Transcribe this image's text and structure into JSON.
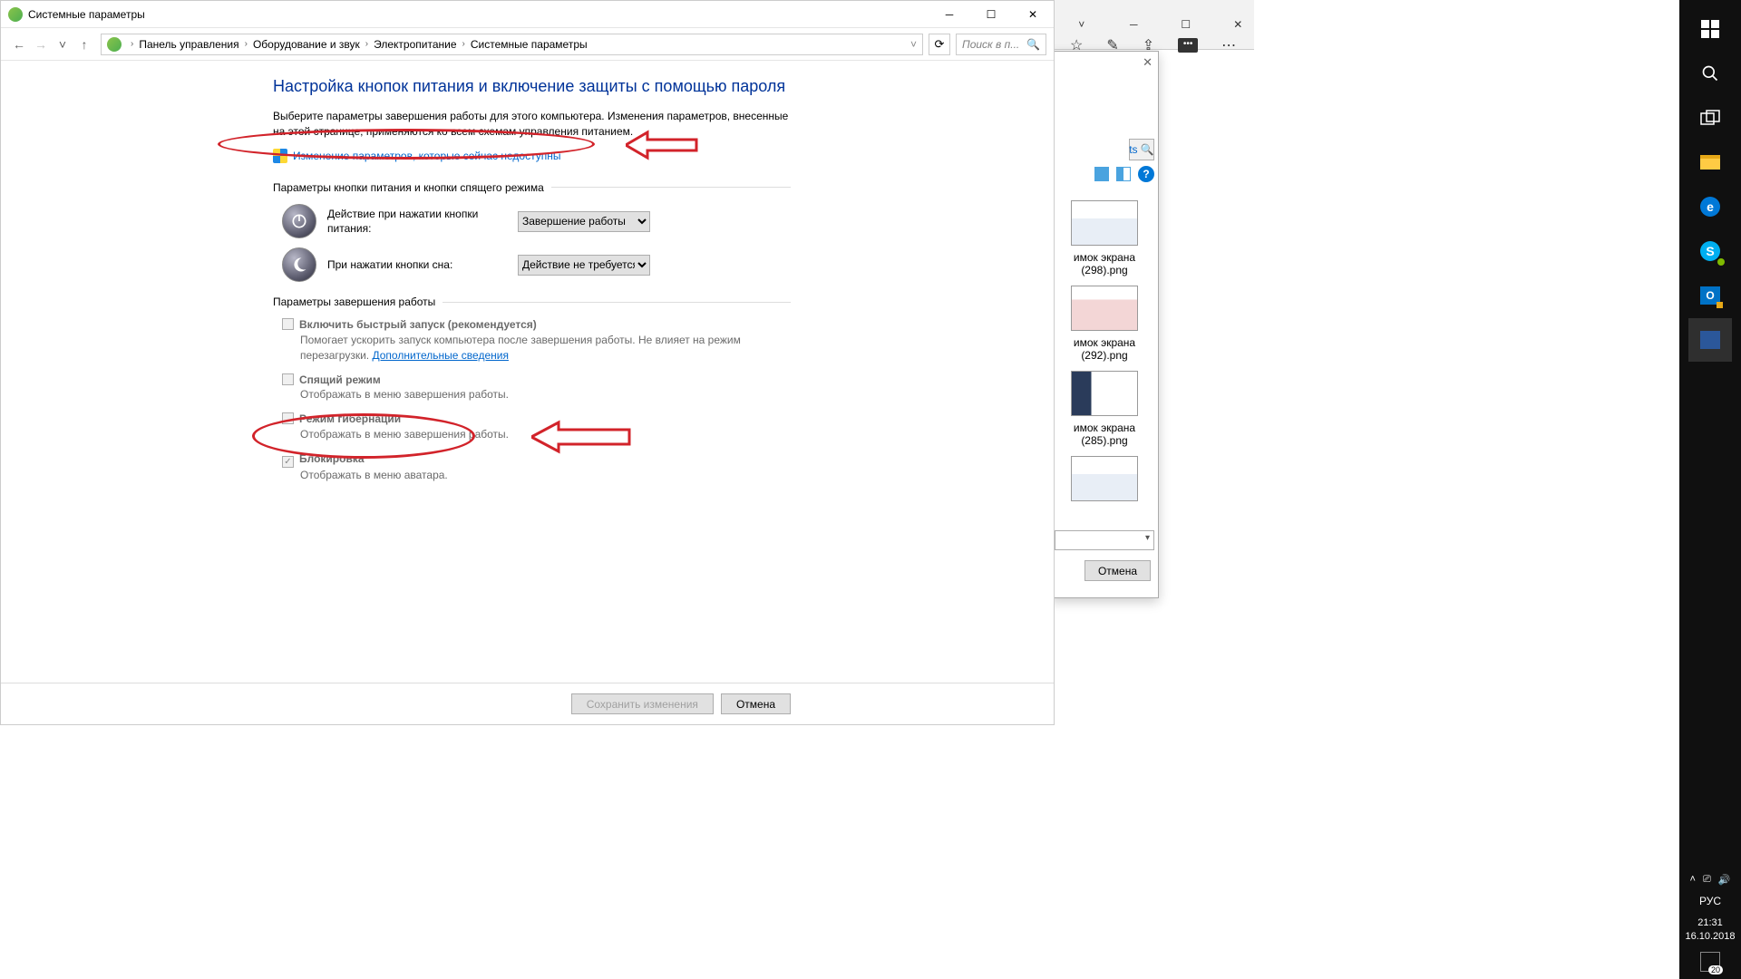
{
  "window": {
    "title": "Системные параметры"
  },
  "breadcrumb": {
    "root": "Панель управления",
    "items": [
      "Оборудование и звук",
      "Электропитание",
      "Системные параметры"
    ]
  },
  "search": {
    "placeholder": "Поиск в п..."
  },
  "page": {
    "heading": "Настройка кнопок питания и включение защиты с помощью пароля",
    "intro": "Выберите параметры завершения работы для этого компьютера. Изменения параметров, внесенные на этой странице, применяются ко всем схемам управления питанием.",
    "uac_link": "Изменение параметров, которые сейчас недоступны",
    "section_buttons": "Параметры кнопки питания и кнопки спящего режима",
    "power_button_label": "Действие при нажатии кнопки питания:",
    "power_button_value": "Завершение работы",
    "sleep_button_label": "При нажатии кнопки сна:",
    "sleep_button_value": "Действие не требуется",
    "section_shutdown": "Параметры завершения работы",
    "opts": [
      {
        "label": "Включить быстрый запуск (рекомендуется)",
        "desc_pre": "Помогает ускорить запуск компьютера после завершения работы. Не влияет на режим перезагрузки. ",
        "link": "Дополнительные сведения",
        "checked": false
      },
      {
        "label": "Спящий режим",
        "desc": "Отображать в меню завершения работы.",
        "checked": false
      },
      {
        "label": "Режим гибернации",
        "desc": "Отображать в меню завершения работы.",
        "checked": false
      },
      {
        "label": "Блокировка",
        "desc": "Отображать в меню аватара.",
        "checked": true
      }
    ],
    "save": "Сохранить изменения",
    "cancel": "Отмена"
  },
  "dialog2": {
    "files": [
      {
        "name_l1": "имок экрана",
        "name_l2": "(298).png"
      },
      {
        "name_l1": "имок экрана",
        "name_l2": "(292).png"
      },
      {
        "name_l1": "имок экрана",
        "name_l2": "(285).png"
      }
    ],
    "search_hint": "ts",
    "cancel": "Отмена"
  },
  "systray": {
    "lang": "РУС",
    "time": "21:31",
    "date": "16.10.2018",
    "notif_count": "20"
  }
}
